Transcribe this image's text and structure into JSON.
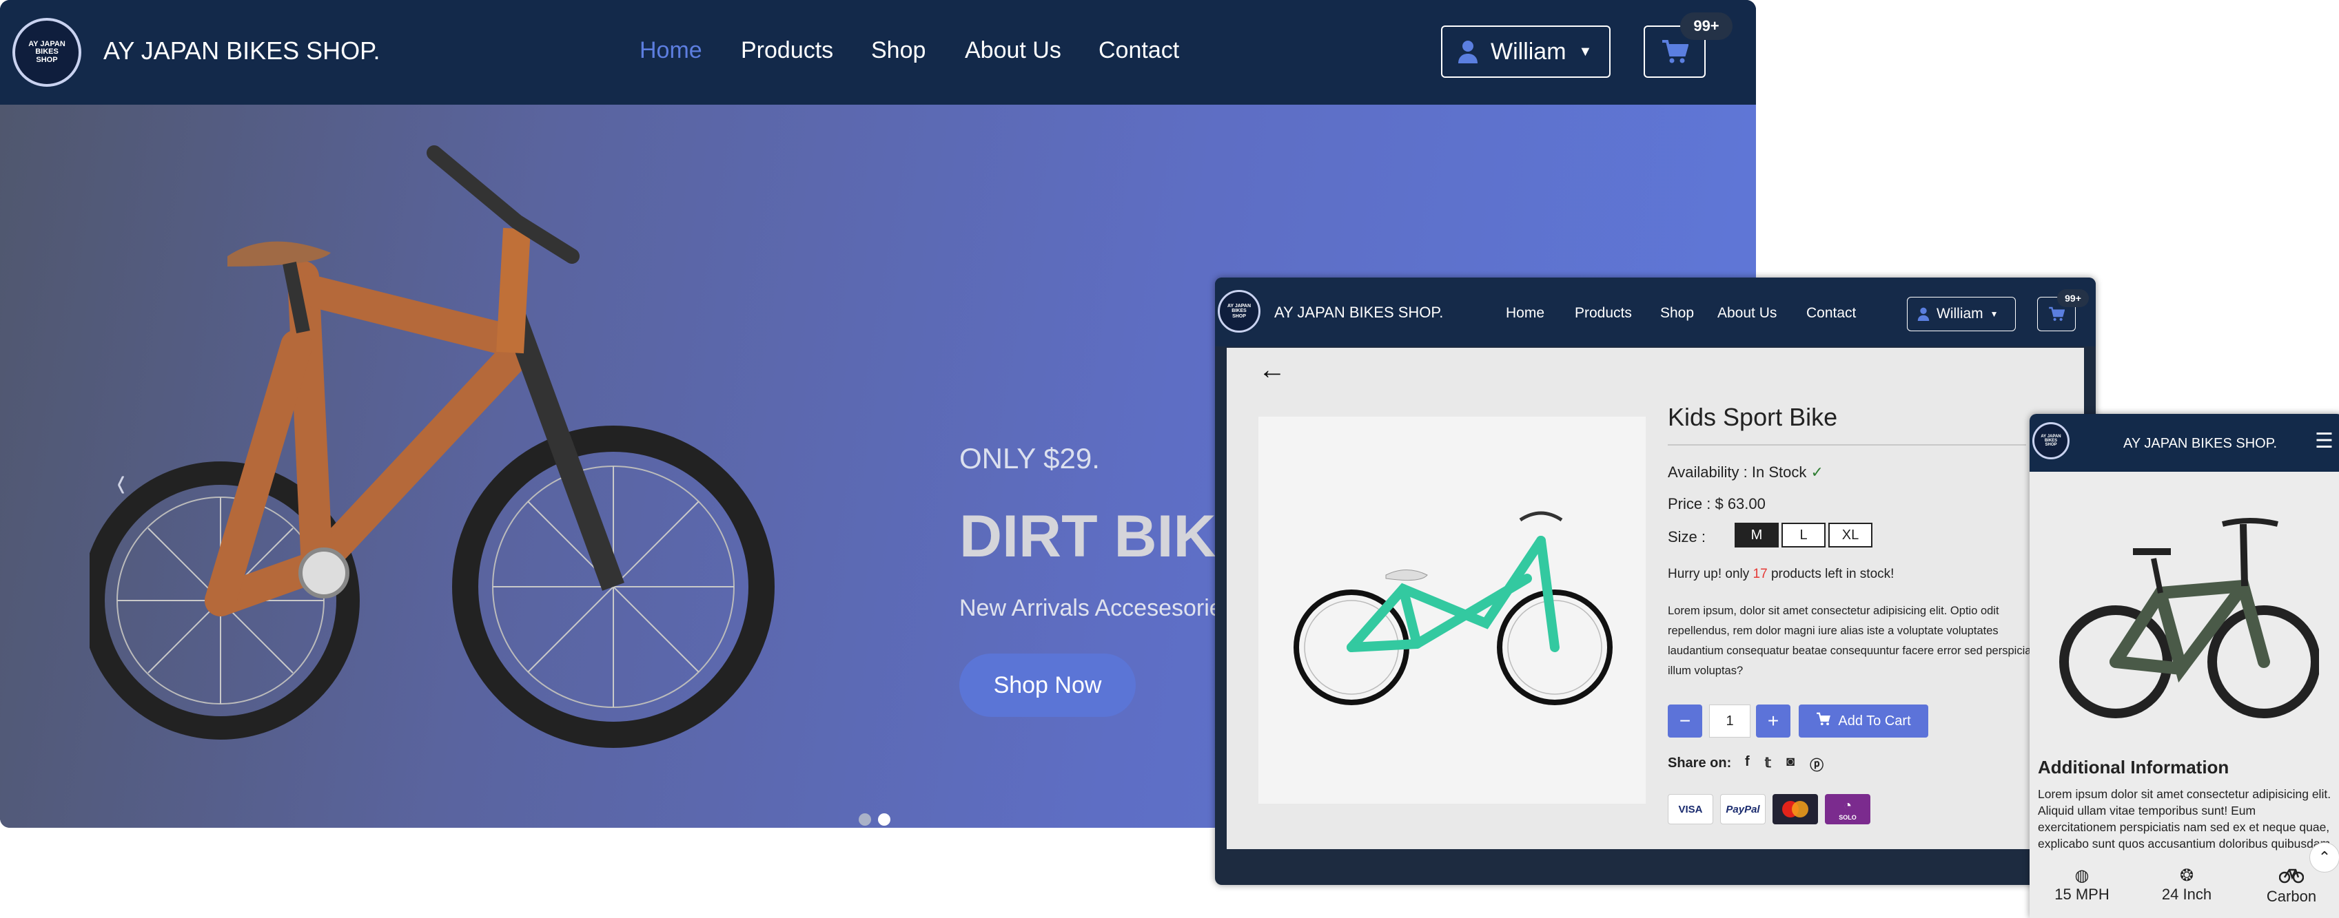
{
  "desktop": {
    "brand": "AY JAPAN BIKES SHOP.",
    "logo_text": "AY JAPAN BIKES SHOP",
    "nav": [
      "Home",
      "Products",
      "Shop",
      "About Us",
      "Contact"
    ],
    "active_nav": "Home",
    "user": "William",
    "cart_badge": "99+",
    "hero": {
      "price": "ONLY $29.",
      "title": "DIRT BIKE",
      "subtitle": "New Arrivals Accesesories",
      "button": "Shop Now",
      "slides": 2,
      "active_slide": 2
    }
  },
  "tablet": {
    "brand": "AY JAPAN BIKES SHOP.",
    "nav": [
      "Home",
      "Products",
      "Shop",
      "About Us",
      "Contact"
    ],
    "active_nav": "Shop",
    "user": "William",
    "cart_badge": "99+",
    "product": {
      "title": "Kids Sport Bike",
      "availability_label": "Availability : ",
      "availability": "In Stock",
      "price_label": "Price : ",
      "price": "$ 63.00",
      "size_label": "Size :",
      "sizes": [
        "M",
        "L",
        "XL"
      ],
      "selected_size": "M",
      "stock_prefix": "Hurry up! only ",
      "stock_count": "17",
      "stock_suffix": " products left in stock!",
      "description": "Lorem ipsum, dolor sit amet consectetur adipisicing elit. Optio odit repellendus, rem dolor magni iure alias iste a voluptate voluptates laudantium consequatur beatae consequuntur facere error sed perspiciatis illum voluptas?",
      "quantity": "1",
      "add_to_cart": "Add To Cart",
      "share_label": "Share on:",
      "payments": [
        "VISA",
        "PayPal",
        "Mastercard",
        "SOLO"
      ]
    }
  },
  "mobile": {
    "brand": "AY JAPAN BIKES SHOP.",
    "heading": "Additional Information",
    "text": "Lorem ipsum dolor sit amet consectetur adipisicing elit. Aliquid ullam vitae temporibus sunt! Eum exercitationem perspiciatis nam sed ex et neque quae, explicabo sunt quos accusantium doloribus quibusdam aliquid quasi?",
    "specs": [
      {
        "icon": "speedometer-icon",
        "label": "15 MPH"
      },
      {
        "icon": "wheel-icon",
        "label": "24 Inch"
      },
      {
        "icon": "bicycle-icon",
        "label": "Carbon"
      }
    ]
  },
  "colors": {
    "navy": "#13294a",
    "accent": "#5c73d9",
    "stock_red": "#e53935",
    "check_green": "#2e7d32"
  }
}
